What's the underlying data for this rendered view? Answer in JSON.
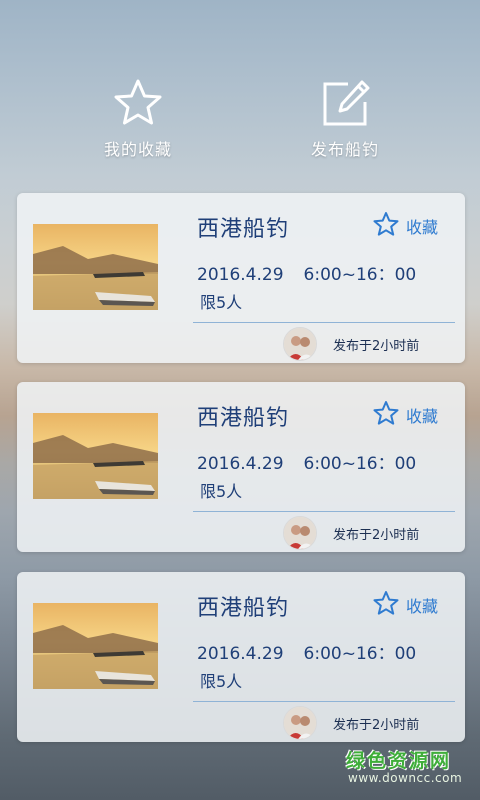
{
  "top_actions": {
    "favorites_label": "我的收藏",
    "publish_label": "发布船钓"
  },
  "cards": [
    {
      "title": "西港船钓",
      "fav_label": "收藏",
      "date": "2016.4.29",
      "time": "6:00~16：00",
      "limit": "限5人",
      "posted": "发布于2小时前"
    },
    {
      "title": "西港船钓",
      "fav_label": "收藏",
      "date": "2016.4.29",
      "time": "6:00~16：00",
      "limit": "限5人",
      "posted": "发布于2小时前"
    },
    {
      "title": "西港船钓",
      "fav_label": "收藏",
      "date": "2016.4.29",
      "time": "6:00~16：00",
      "limit": "限5人",
      "posted": "发布于2小时前"
    }
  ],
  "watermark": {
    "name": "绿色资源网",
    "url": "www.downcc.com"
  },
  "colors": {
    "title": "#1f3f78",
    "accent": "#2f7bd0",
    "watermark": "#3fae3a"
  },
  "icons": {
    "favorites": "star-outline-icon",
    "publish": "edit-icon",
    "card_fav": "star-outline-icon"
  }
}
